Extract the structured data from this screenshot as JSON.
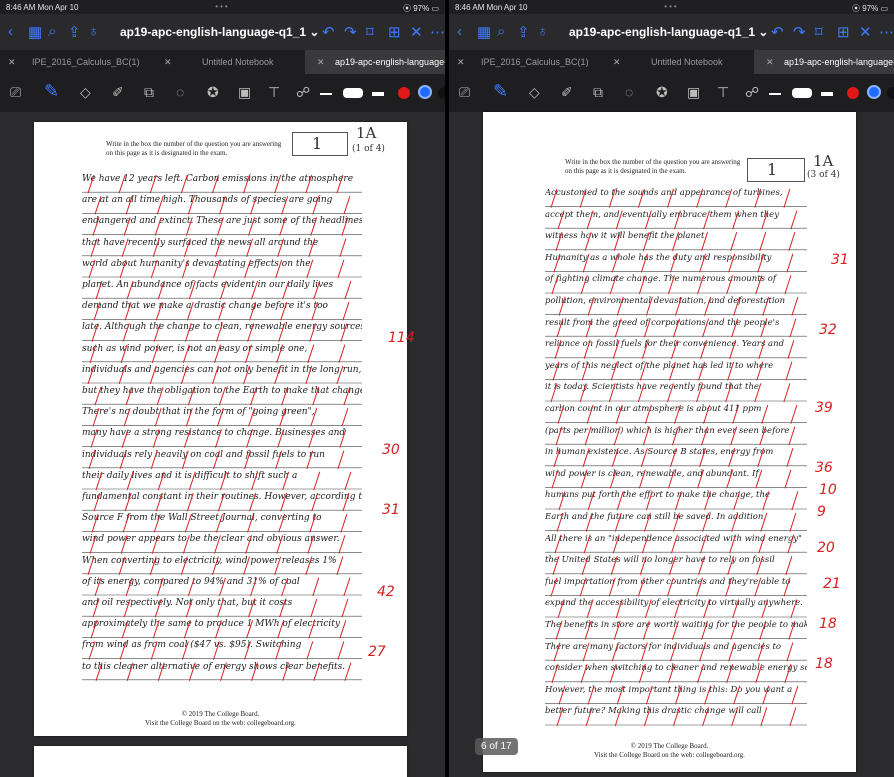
{
  "left": {
    "status": {
      "time": "8:46 AM  Mon Apr 10",
      "dots": "•••",
      "battery": "⦿ 97% ▭"
    },
    "nav": {
      "title": "ap19-apc-english-language-q1_1 ⌄"
    },
    "tabs": [
      {
        "label": "IPE_2016_Calculus_BC(1)",
        "active": false
      },
      {
        "label": "Untitled Notebook",
        "active": false
      },
      {
        "label": "ap19-apc-english-language-...",
        "active": true
      }
    ],
    "page": {
      "instruction": "Write in the box the number of the question you are answering on this page as it is designated in the exam.",
      "question_number": "1",
      "label": "1A",
      "label_sub": "(1 of 4)",
      "handwriting": [
        "We have 12 years left. Carbon emissions in the atmosphere",
        "are at an all time high. Thousands of species are going",
        "endangered and extinct. These are just some of the headlines",
        "that have recently surfaced the news all around the",
        "world about humanity's devastating effects on the",
        "planet. An abundance of facts evident in our daily lives",
        "demand that we make a drastic change before it's too",
        "late. Although the change to clean, renewable energy sources",
        "such as wind power, is not an easy or simple one,",
        "individuals and agencies can not only benefit in the long run,",
        "but they have the obligation to the Earth to make that change.",
        "There's no doubt that in the form of \"going green\",",
        "many have a strong resistance to change. Businesses and",
        "individuals rely heavily on coal and fossil fuels to run",
        "their daily lives and it is difficult to shift such a",
        "fundamental constant in their routines. However, according to",
        "Source F from the Wall Street Journal, converting to",
        "wind power appears to be the clear and obvious answer.",
        "When converting to electricity, wind power releases 1%",
        "of its energy, compared to 94% and 31% of coal",
        "and oil respectively. Not only that, but it costs",
        "approximately the same to produce 1 MWh of electricity",
        "from wind as from coal ($47 vs. $95). Switching",
        "to this cleaner alternative of energy shows clear benefits."
      ],
      "scores": [
        "114",
        "30",
        "31",
        "42",
        "27"
      ],
      "footer_line1": "© 2019 The College Board.",
      "footer_line2": "Visit the College Board on the web: collegeboard.org."
    }
  },
  "right": {
    "status": {
      "time": "8:46 AM  Mon Apr 10",
      "dots": "•••",
      "battery": "⦿ 97% ▭"
    },
    "nav": {
      "title": "ap19-apc-english-language-q1_1 ⌄"
    },
    "tabs": [
      {
        "label": "IPE_2016_Calculus_BC(1)",
        "active": false
      },
      {
        "label": "Untitled Notebook",
        "active": false
      },
      {
        "label": "ap19-apc-english-language-...",
        "active": true
      }
    ],
    "page": {
      "instruction": "Write in the box the number of the question you are answering on this page as it is designated in the exam.",
      "question_number": "1",
      "label": "1A",
      "label_sub": "(3 of 4)",
      "handwriting": [
        "Accustomed to the sounds and appearance of turbines,",
        "accept them, and eventually embrace them when they",
        "witness how it will benefit the planet.",
        "Humanity as a whole has the duty and responsibility",
        "of fighting climate change. The numerous amounts of",
        "pollution, environmental devastation, and deforestation",
        "result from the greed of corporations and the people's",
        "reliance on fossil fuels for their convenience. Years and",
        "years of this neglect of the planet has led it to where",
        "it is today. Scientists have recently found that the",
        "carbon count in our atmosphere is about 411 ppm",
        "(parts per million) which is higher than ever seen before",
        "in human existence. As Source B states, energy from",
        "wind power is clean, renewable, and abundant. If",
        "humans put forth the effort to make the change, the",
        "Earth and the future can still be saved. In addition,",
        "All there is an \"independence associated with wind energy\"",
        "the United States will no longer have to rely on fossil",
        "fuel importation from other countries and they're able to",
        "expand the accessibility of electricity to virtually anywhere.",
        "The benefits in store are worth waiting for the people to make a change.",
        "There are many factors for individuals and agencies to",
        "consider when switching to cleaner and renewable energy sources.",
        "However, the most important thing is this: Do you want a",
        "better future? Making this drastic change will call"
      ],
      "scores": [
        "31",
        "32",
        "39",
        "36",
        "10",
        "9",
        "20",
        "21",
        "18",
        "18"
      ],
      "footer_line1": "© 2019 The College Board.",
      "footer_line2": "Visit the College Board on the web: collegeboard.org.",
      "page_indicator": "6 of 17"
    }
  },
  "icons": {
    "nav": [
      "chevron-left-icon",
      "grid-icon",
      "search-icon",
      "share-icon",
      "mic-icon",
      "undo-icon",
      "redo-icon",
      "bookmark-icon",
      "add-page-icon",
      "close-icon",
      "more-icon"
    ],
    "tools": [
      "lasso-text-icon",
      "pen-icon",
      "eraser-icon",
      "highlighter-icon",
      "shapes-icon",
      "lasso-icon",
      "star-icon",
      "image-icon",
      "textbox-icon",
      "link-icon"
    ]
  },
  "colors": {
    "accent": "#3e7bff",
    "ink_red": "#d82020",
    "color_black": "#111111",
    "color_red": "#e01818",
    "color_blue": "#1e6bff"
  }
}
